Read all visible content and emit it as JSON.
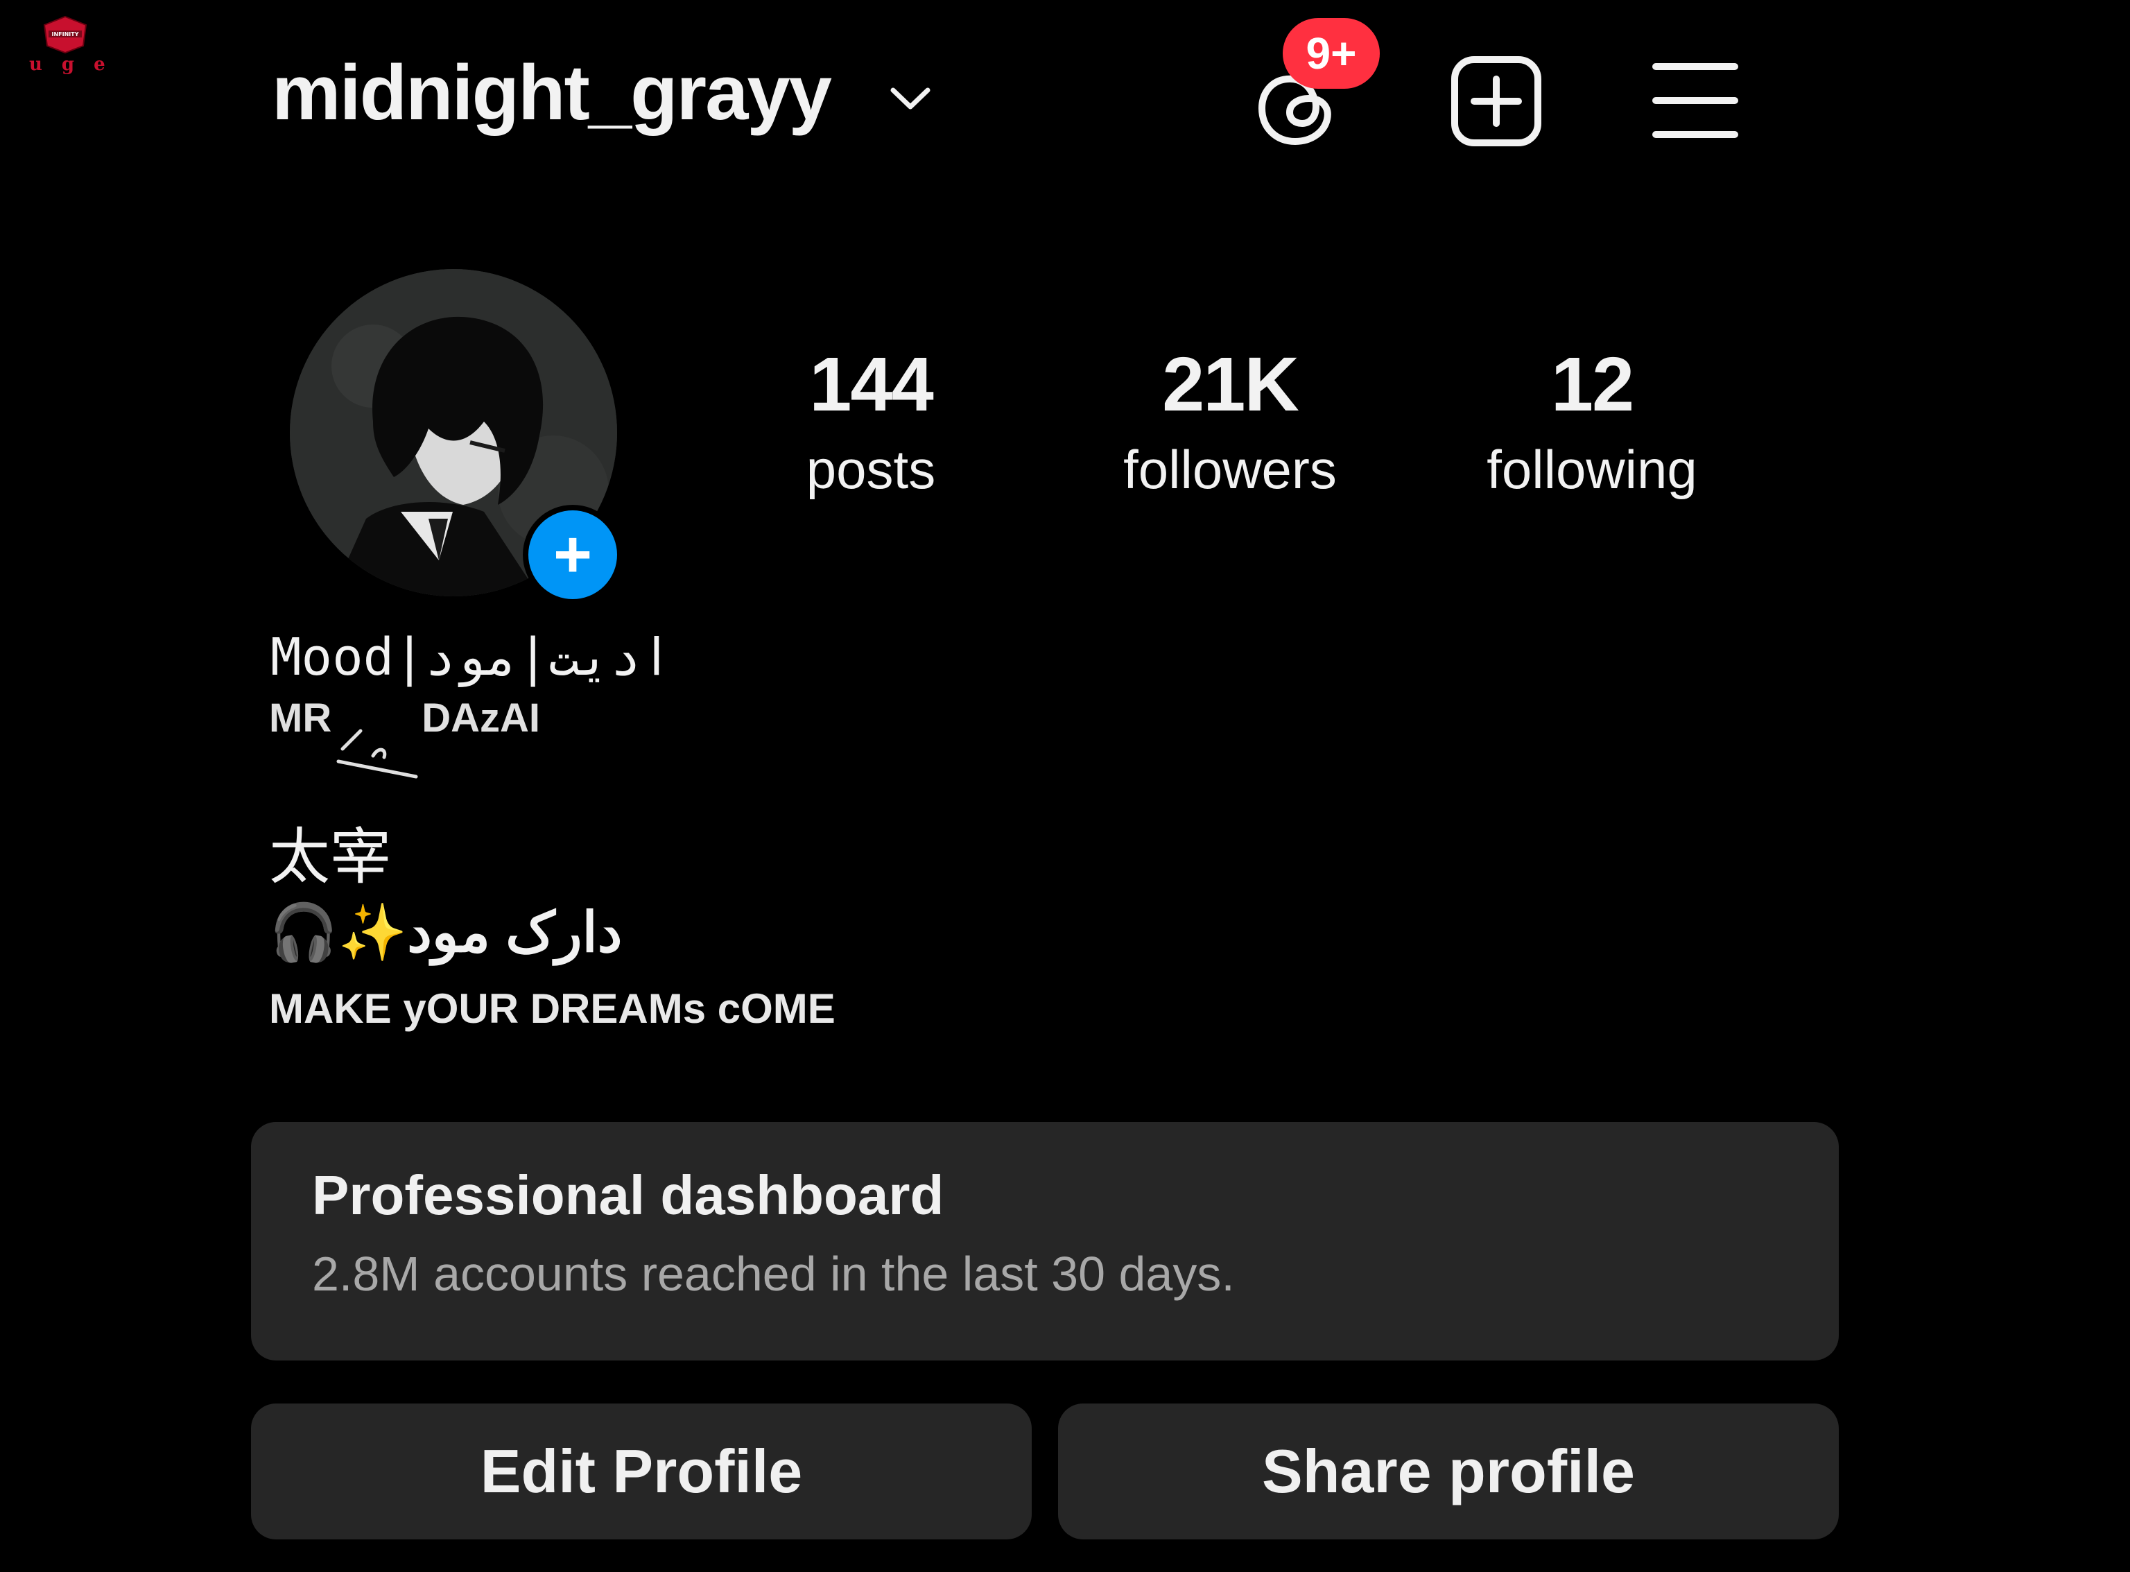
{
  "watermark": {
    "text": "uge",
    "logo_text": "INFINITY"
  },
  "header": {
    "username": "midnight_grayy",
    "threads_badge": "9+",
    "colors": {
      "badge": "#ff3040",
      "add_story": "#0095f6",
      "background": "#000000",
      "card": "#262626"
    }
  },
  "stats": [
    {
      "value": "144",
      "label": "posts"
    },
    {
      "value": "21K",
      "label": "followers"
    },
    {
      "value": "12",
      "label": "following"
    }
  ],
  "bio": {
    "display_name": "Mood|ادیت|مود",
    "sub_left": "MR",
    "sub_right": "DAzAI",
    "line_cjk": "太宰",
    "line_mood": "دارک مود✨🎧",
    "line_make": "MAKE yOUR DREAMs cOME"
  },
  "dashboard": {
    "title": "Professional dashboard",
    "subtitle": "2.8M accounts reached in the last 30 days."
  },
  "buttons": {
    "edit": "Edit Profile",
    "share": "Share profile"
  },
  "icons": [
    "chevron-down-icon",
    "threads-icon",
    "add-post-icon",
    "menu-icon",
    "add-story-icon"
  ]
}
